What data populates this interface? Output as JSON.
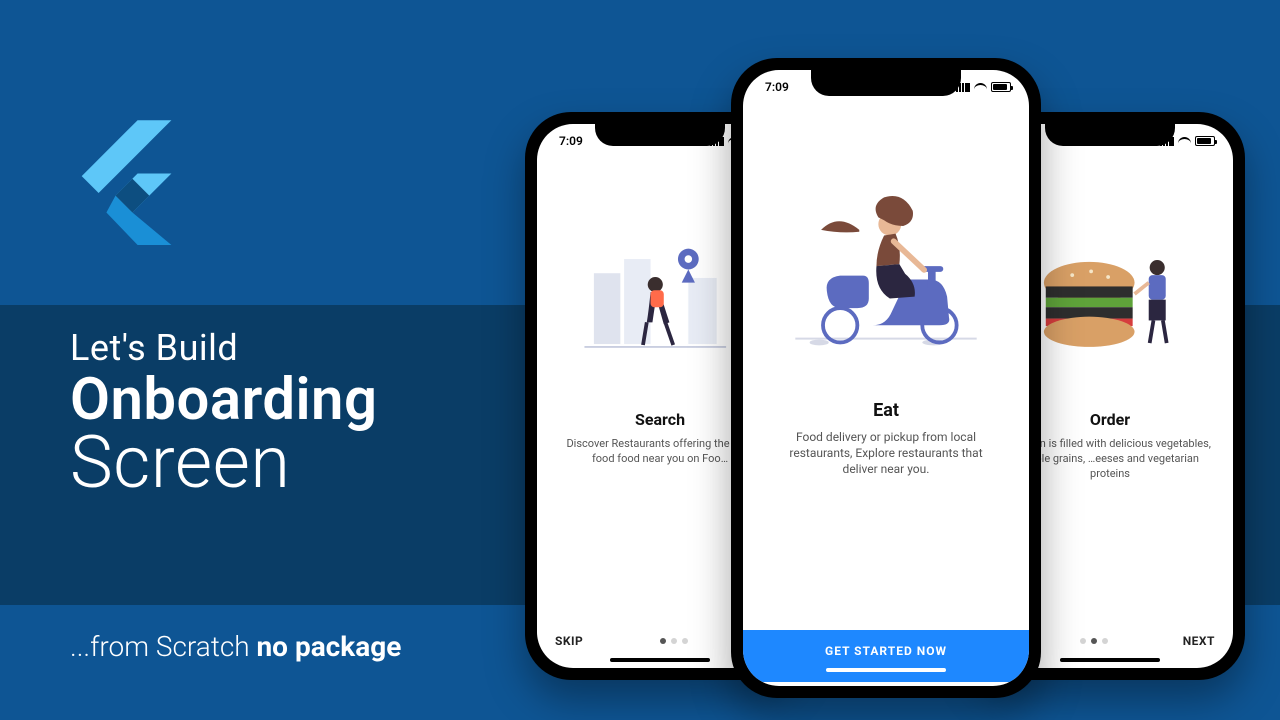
{
  "banner": {
    "line1": "Let's Build",
    "line2": "Onboarding",
    "line3": "Screen",
    "sub_prefix": "...from Scratch ",
    "sub_bold": "no package"
  },
  "colors": {
    "bg": "#0e5594",
    "band": "#0a3d66",
    "cta": "#1e88ff"
  },
  "statusbar": {
    "time": "7:09"
  },
  "phones": {
    "left": {
      "title": "Search",
      "desc": "Discover Restaurants offering the best food food near you on Foo…",
      "footer_left": "SKIP",
      "footer_right": "",
      "active_dot": 1
    },
    "center": {
      "title": "Eat",
      "desc": "Food delivery or pickup from local restaurants, Explore restaurants that deliver near you.",
      "cta": "GET STARTED NOW"
    },
    "right": {
      "title": "Order",
      "desc": "…e plan is filled with delicious vegetables, whole grains, …eeses and vegetarian proteins",
      "footer_left": "",
      "footer_right": "NEXT",
      "active_dot": 2
    }
  }
}
